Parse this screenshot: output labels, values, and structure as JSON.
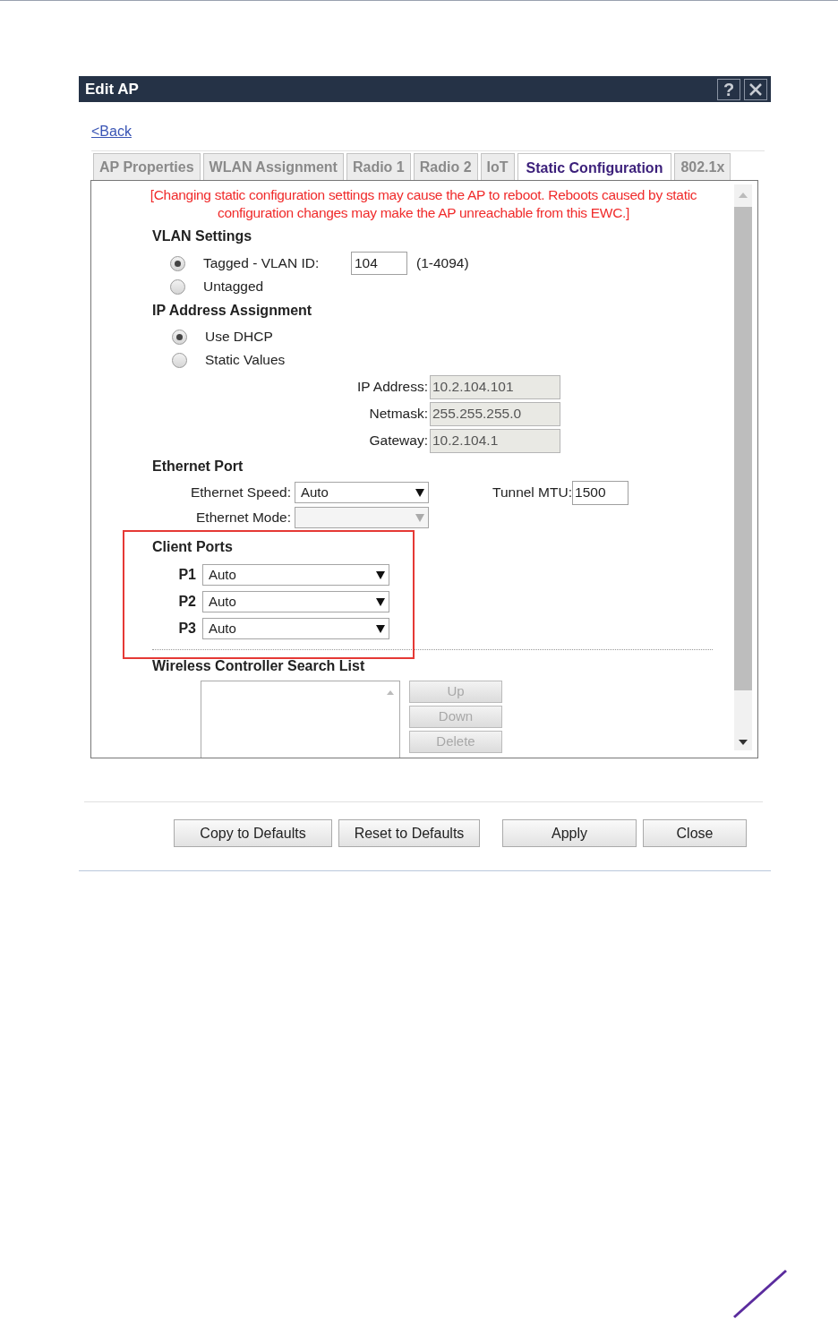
{
  "dialog": {
    "title": "Edit AP",
    "help_button": "?"
  },
  "back_link": "<Back",
  "tabs": [
    {
      "label": "AP Properties",
      "selected": false
    },
    {
      "label": "WLAN Assignment",
      "selected": false
    },
    {
      "label": "Radio 1",
      "selected": false
    },
    {
      "label": "Radio 2",
      "selected": false
    },
    {
      "label": "IoT",
      "selected": false
    },
    {
      "label": "Static Configuration",
      "selected": true
    },
    {
      "label": "802.1x",
      "selected": false
    }
  ],
  "warning": "[Changing static configuration settings may cause the AP to reboot. Reboots caused by static configuration changes may make the AP unreachable from this EWC.]",
  "vlan_settings": {
    "heading": "VLAN Settings",
    "options": [
      {
        "label": "Tagged - VLAN ID:",
        "selected": true
      },
      {
        "label": "Untagged",
        "selected": false
      }
    ],
    "vlan_id": "104",
    "range": "(1-4094)"
  },
  "ip_assignment": {
    "heading": "IP Address Assignment",
    "options": [
      {
        "label": "Use DHCP",
        "selected": true
      },
      {
        "label": "Static Values",
        "selected": false
      }
    ],
    "fields": [
      {
        "label": "IP Address:",
        "value": "10.2.104.101",
        "disabled": true
      },
      {
        "label": "Netmask:",
        "value": "255.255.255.0",
        "disabled": true
      },
      {
        "label": "Gateway:",
        "value": "10.2.104.1",
        "disabled": true
      }
    ]
  },
  "ethernet_port": {
    "heading": "Ethernet Port",
    "speed": {
      "label": "Ethernet Speed:",
      "value": "Auto",
      "disabled": false
    },
    "mode": {
      "label": "Ethernet Mode:",
      "disabled": true
    },
    "tunnel_mtu": {
      "label": "Tunnel MTU:",
      "value": "1500"
    }
  },
  "client_ports": {
    "heading": "Client Ports",
    "ports": [
      {
        "label": "P1",
        "value": "Auto"
      },
      {
        "label": "P2",
        "value": "Auto"
      },
      {
        "label": "P3",
        "value": "Auto"
      }
    ]
  },
  "search_list": {
    "heading": "Wireless Controller Search List",
    "buttons": [
      {
        "label": "Up",
        "disabled": true
      },
      {
        "label": "Down",
        "disabled": true
      },
      {
        "label": "Delete",
        "disabled": true
      }
    ]
  },
  "footer_buttons": [
    "Copy to Defaults",
    "Reset to Defaults",
    "Apply",
    "Close"
  ]
}
